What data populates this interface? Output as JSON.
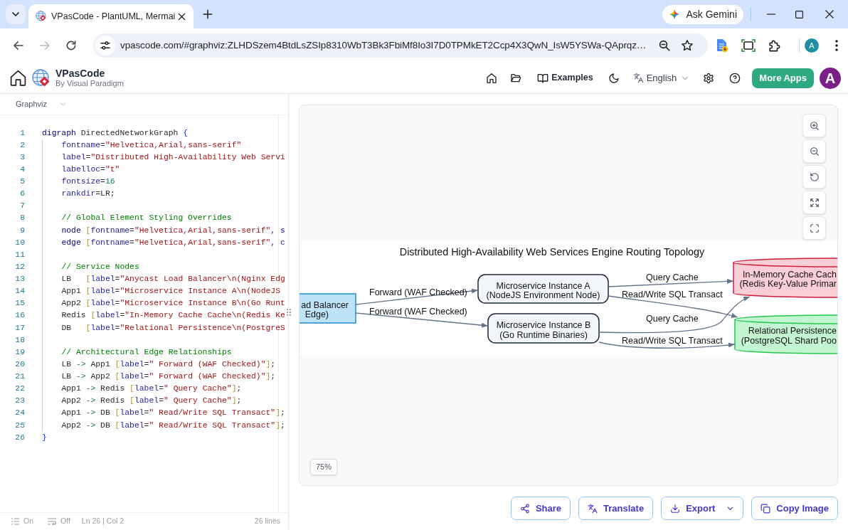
{
  "browser": {
    "tab_title": "VPasCode - PlantUML, Mermai",
    "gemini_button": "Ask Gemini",
    "nav": [
      {
        "kind": "back",
        "disabled": false
      },
      {
        "kind": "forward",
        "disabled": true
      },
      {
        "kind": "reload",
        "disabled": false
      }
    ],
    "url": "vpascode.com/#graphviz:ZLHDSzem4BtdLsZSIp8310WbT3Bk3FbiMf8Io3I7D0TPMkET2Ccp4X3QwN_IsW5YSWa-QAprqz…",
    "profile_initial": "A"
  },
  "header": {
    "brand": "VPasCode",
    "tagline": "By Visual Paradigm",
    "examples": "Examples",
    "language": "English",
    "more_apps": "More Apps",
    "avatar_initial": "A"
  },
  "editor": {
    "language": "Graphviz",
    "lines": [
      {
        "number": "1",
        "tokens": [
          {
            "kind": "keyword",
            "text": "digraph"
          },
          {
            "kind": "name",
            "text": " DirectedNetworkGraph "
          },
          {
            "kind": "brace",
            "text": "{"
          }
        ],
        "children": [
          {
            "number": "2",
            "tokens": [
              {
                "kind": "attribute",
                "text": "fontname"
              },
              {
                "kind": "operator",
                "text": "="
              },
              {
                "kind": "string",
                "text": "\"Helvetica,Arial,sans-serif\""
              }
            ]
          },
          {
            "number": "3",
            "tokens": [
              {
                "kind": "attribute",
                "text": "label"
              },
              {
                "kind": "operator",
                "text": "="
              },
              {
                "kind": "string",
                "text": "\"Distributed High-Availability Web Servi"
              }
            ]
          },
          {
            "number": "4",
            "tokens": [
              {
                "kind": "attribute",
                "text": "labelloc"
              },
              {
                "kind": "operator",
                "text": "="
              },
              {
                "kind": "string",
                "text": "\"t\""
              }
            ]
          },
          {
            "number": "5",
            "tokens": [
              {
                "kind": "attribute",
                "text": "fontsize"
              },
              {
                "kind": "operator",
                "text": "="
              },
              {
                "kind": "number",
                "text": "16"
              }
            ]
          },
          {
            "number": "6",
            "tokens": [
              {
                "kind": "attribute",
                "text": "rankdir"
              },
              {
                "kind": "operator",
                "text": "="
              },
              {
                "kind": "name",
                "text": "LR"
              },
              {
                "kind": "operator",
                "text": ";"
              }
            ]
          },
          {
            "number": "7"
          },
          {
            "number": "8",
            "tokens": [
              {
                "kind": "comment",
                "text": "// Global Element Styling Overrides"
              }
            ]
          },
          {
            "number": "9",
            "tokens": [
              {
                "kind": "keyword",
                "text": "node"
              },
              {
                "kind": "bracket",
                "text": " ["
              },
              {
                "kind": "attribute",
                "text": "fontname"
              },
              {
                "kind": "operator",
                "text": "="
              },
              {
                "kind": "string",
                "text": "\"Helvetica,Arial,sans-serif\""
              },
              {
                "kind": "operator",
                "text": ", "
              },
              {
                "kind": "attribute",
                "text": "s"
              }
            ]
          },
          {
            "number": "10",
            "tokens": [
              {
                "kind": "keyword",
                "text": "edge"
              },
              {
                "kind": "bracket",
                "text": " ["
              },
              {
                "kind": "attribute",
                "text": "fontname"
              },
              {
                "kind": "operator",
                "text": "="
              },
              {
                "kind": "string",
                "text": "\"Helvetica,Arial,sans-serif\""
              },
              {
                "kind": "operator",
                "text": ", "
              },
              {
                "kind": "attribute",
                "text": "c"
              }
            ]
          },
          {
            "number": "11"
          },
          {
            "number": "12",
            "tokens": [
              {
                "kind": "comment",
                "text": "// Service Nodes"
              }
            ]
          },
          {
            "number": "13",
            "tokens": [
              {
                "kind": "name",
                "text": "LB"
              },
              {
                "kind": "bracket",
                "text": "   ["
              },
              {
                "kind": "attribute",
                "text": "label"
              },
              {
                "kind": "operator",
                "text": "="
              },
              {
                "kind": "string",
                "text": "\"Anycast Load Balancer\\n(Nginx Edg"
              }
            ]
          },
          {
            "number": "14",
            "tokens": [
              {
                "kind": "name",
                "text": "App1"
              },
              {
                "kind": "bracket",
                "text": " ["
              },
              {
                "kind": "attribute",
                "text": "label"
              },
              {
                "kind": "operator",
                "text": "="
              },
              {
                "kind": "string",
                "text": "\"Microservice Instance A\\n(NodeJS"
              }
            ]
          },
          {
            "number": "15",
            "tokens": [
              {
                "kind": "name",
                "text": "App2"
              },
              {
                "kind": "bracket",
                "text": " ["
              },
              {
                "kind": "attribute",
                "text": "label"
              },
              {
                "kind": "operator",
                "text": "="
              },
              {
                "kind": "string",
                "text": "\"Microservice Instance B\\n(Go Runt"
              }
            ]
          },
          {
            "number": "16",
            "tokens": [
              {
                "kind": "name",
                "text": "Redis"
              },
              {
                "kind": "bracket",
                "text": " ["
              },
              {
                "kind": "attribute",
                "text": "label"
              },
              {
                "kind": "operator",
                "text": "="
              },
              {
                "kind": "string",
                "text": "\"In-Memory Cache Cache\\n(Redis Ke"
              }
            ]
          },
          {
            "number": "17",
            "tokens": [
              {
                "kind": "name",
                "text": "DB"
              },
              {
                "kind": "bracket",
                "text": "   ["
              },
              {
                "kind": "attribute",
                "text": "label"
              },
              {
                "kind": "operator",
                "text": "="
              },
              {
                "kind": "string",
                "text": "\"Relational Persistence\\n(PostgreS"
              }
            ]
          },
          {
            "number": "18"
          },
          {
            "number": "19",
            "tokens": [
              {
                "kind": "comment",
                "text": "// Architectural Edge Relationships"
              }
            ]
          },
          {
            "number": "20",
            "tokens": [
              {
                "kind": "name",
                "text": "LB"
              },
              {
                "kind": "arrow",
                "text": " -> "
              },
              {
                "kind": "name",
                "text": "App1"
              },
              {
                "kind": "bracket",
                "text": " ["
              },
              {
                "kind": "attribute",
                "text": "label"
              },
              {
                "kind": "operator",
                "text": "="
              },
              {
                "kind": "string",
                "text": "\" Forward (WAF Checked)\""
              },
              {
                "kind": "bracket",
                "text": "]"
              },
              {
                "kind": "operator",
                "text": ";"
              }
            ]
          },
          {
            "number": "21",
            "tokens": [
              {
                "kind": "name",
                "text": "LB"
              },
              {
                "kind": "arrow",
                "text": " -> "
              },
              {
                "kind": "name",
                "text": "App2"
              },
              {
                "kind": "bracket",
                "text": " ["
              },
              {
                "kind": "attribute",
                "text": "label"
              },
              {
                "kind": "operator",
                "text": "="
              },
              {
                "kind": "string",
                "text": "\" Forward (WAF Checked)\""
              },
              {
                "kind": "bracket",
                "text": "]"
              },
              {
                "kind": "operator",
                "text": ";"
              }
            ]
          },
          {
            "number": "22",
            "tokens": [
              {
                "kind": "name",
                "text": "App1"
              },
              {
                "kind": "arrow",
                "text": " -> "
              },
              {
                "kind": "name",
                "text": "Redis"
              },
              {
                "kind": "bracket",
                "text": " ["
              },
              {
                "kind": "attribute",
                "text": "label"
              },
              {
                "kind": "operator",
                "text": "="
              },
              {
                "kind": "string",
                "text": "\" Query Cache\""
              },
              {
                "kind": "bracket",
                "text": "]"
              },
              {
                "kind": "operator",
                "text": ";"
              }
            ]
          },
          {
            "number": "23",
            "tokens": [
              {
                "kind": "name",
                "text": "App2"
              },
              {
                "kind": "arrow",
                "text": " -> "
              },
              {
                "kind": "name",
                "text": "Redis"
              },
              {
                "kind": "bracket",
                "text": " ["
              },
              {
                "kind": "attribute",
                "text": "label"
              },
              {
                "kind": "operator",
                "text": "="
              },
              {
                "kind": "string",
                "text": "\" Query Cache\""
              },
              {
                "kind": "bracket",
                "text": "]"
              },
              {
                "kind": "operator",
                "text": ";"
              }
            ]
          },
          {
            "number": "24",
            "tokens": [
              {
                "kind": "name",
                "text": "App1"
              },
              {
                "kind": "arrow",
                "text": " -> "
              },
              {
                "kind": "name",
                "text": "DB"
              },
              {
                "kind": "bracket",
                "text": " ["
              },
              {
                "kind": "attribute",
                "text": "label"
              },
              {
                "kind": "operator",
                "text": "="
              },
              {
                "kind": "string",
                "text": "\" Read/Write SQL Transact\""
              },
              {
                "kind": "bracket",
                "text": "]"
              },
              {
                "kind": "operator",
                "text": ";"
              }
            ]
          },
          {
            "number": "25",
            "tokens": [
              {
                "kind": "name",
                "text": "App2"
              },
              {
                "kind": "arrow",
                "text": " -> "
              },
              {
                "kind": "name",
                "text": "DB"
              },
              {
                "kind": "bracket",
                "text": " ["
              },
              {
                "kind": "attribute",
                "text": "label"
              },
              {
                "kind": "operator",
                "text": "="
              },
              {
                "kind": "string",
                "text": "\" Read/Write SQL Transact\""
              },
              {
                "kind": "bracket",
                "text": "]"
              },
              {
                "kind": "operator",
                "text": ";"
              }
            ]
          }
        ]
      },
      {
        "number": "26",
        "tokens": [
          {
            "kind": "brace",
            "text": "}"
          }
        ]
      }
    ],
    "status_bar": {
      "indent_guides": "On",
      "word_wrap": "Off",
      "cursor_position": "Ln 26 | Col 2",
      "line_count": "26 lines"
    }
  },
  "preview": {
    "diagram": {
      "title": "Distributed High-Availability Web Services Engine Routing Topology",
      "nodes": [
        {
          "kind": "box",
          "color": "#bee3f8",
          "lines": [
            "ad Balancer",
            "Edge)"
          ]
        },
        {
          "kind": "rounded",
          "color": "#f3f6fa",
          "lines": [
            "Microservice Instance A",
            "(NodeJS Environment Node)"
          ]
        },
        {
          "kind": "rounded",
          "color": "#f3f6fa",
          "lines": [
            "Microservice Instance B",
            "(Go Runtime Binaries)"
          ]
        },
        {
          "kind": "cylinder",
          "color": "#fbcdd5",
          "lines": [
            "In-Memory Cache Cach",
            "(Redis Key-Value Primar"
          ]
        },
        {
          "kind": "cylinder",
          "color": "#c3f5d0",
          "lines": [
            "Relational Persistence",
            "(PostgreSQL Shard Poo"
          ]
        }
      ],
      "edges": [
        {
          "label": "Query Cache"
        },
        {
          "label": "Forward (WAF Checked)"
        },
        {
          "label": "Read/Write SQL Transact"
        },
        {
          "label": "Forward (WAF Checked)"
        },
        {
          "label": "Query Cache"
        },
        {
          "label": "Read/Write SQL Transact"
        }
      ]
    },
    "zoom_level": "75%",
    "actions": [
      {
        "kind": "share",
        "label": "Share",
        "dropdown": false
      },
      {
        "kind": "translate",
        "label": "Translate",
        "dropdown": false
      },
      {
        "kind": "export",
        "label": "Export",
        "dropdown": true
      },
      {
        "kind": "copy",
        "label": "Copy Image",
        "dropdown": false
      }
    ]
  }
}
